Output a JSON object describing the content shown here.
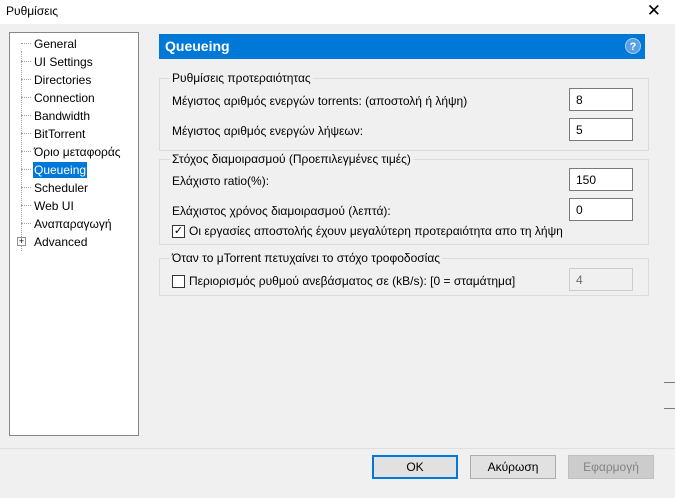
{
  "window": {
    "title": "Ρυθμίσεις",
    "close_glyph": "✕"
  },
  "tree": {
    "items": [
      {
        "label": "General"
      },
      {
        "label": "UI Settings"
      },
      {
        "label": "Directories"
      },
      {
        "label": "Connection"
      },
      {
        "label": "Bandwidth"
      },
      {
        "label": "BitTorrent"
      },
      {
        "label": "Όριο μεταφοράς"
      },
      {
        "label": "Queueing",
        "selected": true
      },
      {
        "label": "Scheduler"
      },
      {
        "label": "Web UI"
      },
      {
        "label": "Αναπαραγωγή"
      },
      {
        "label": "Advanced",
        "expandable": true,
        "expander": "+"
      }
    ]
  },
  "header": {
    "title": "Queueing",
    "help_glyph": "?",
    "help_icon": "help-icon"
  },
  "priority": {
    "title": "Ρυθμίσεις προτεραιότητας",
    "max_active_label": "Μέγιστος αριθμός ενεργών torrents: (αποστολή ή λήψη)",
    "max_active_value": "8",
    "max_downloads_label": "Μέγιστος αριθμός ενεργών λήψεων:",
    "max_downloads_value": "5"
  },
  "seeding": {
    "title": "Στόχος διαμοιρασμού (Προεπιλεγμένες τιμές)",
    "min_ratio_label": "Ελάχιστο ratio(%):",
    "min_ratio_value": "150",
    "min_time_label": "Ελάχιστος χρόνος διαμοιρασμού (λεπτά):",
    "min_time_value": "0",
    "priority_check_label": "Οι εργασίες αποστολής έχουν μεγαλύτερη προτεραιότητα απο τη λήψη",
    "priority_checked": true,
    "check_glyph": "✓"
  },
  "goal": {
    "title": "Όταν το μTorrent πετυχαίνει το στόχο τροφοδοσίας",
    "limit_label": "Περιορισμός ρυθμού ανεβάσματος σε (kB/s): [0 = σταμάτημα]",
    "limit_checked": false,
    "limit_value": "4"
  },
  "buttons": {
    "ok": "OK",
    "cancel": "Ακύρωση",
    "apply": "Εφαρμογή"
  },
  "colors": {
    "accent": "#0078d7",
    "header_text": "#ffffff"
  }
}
